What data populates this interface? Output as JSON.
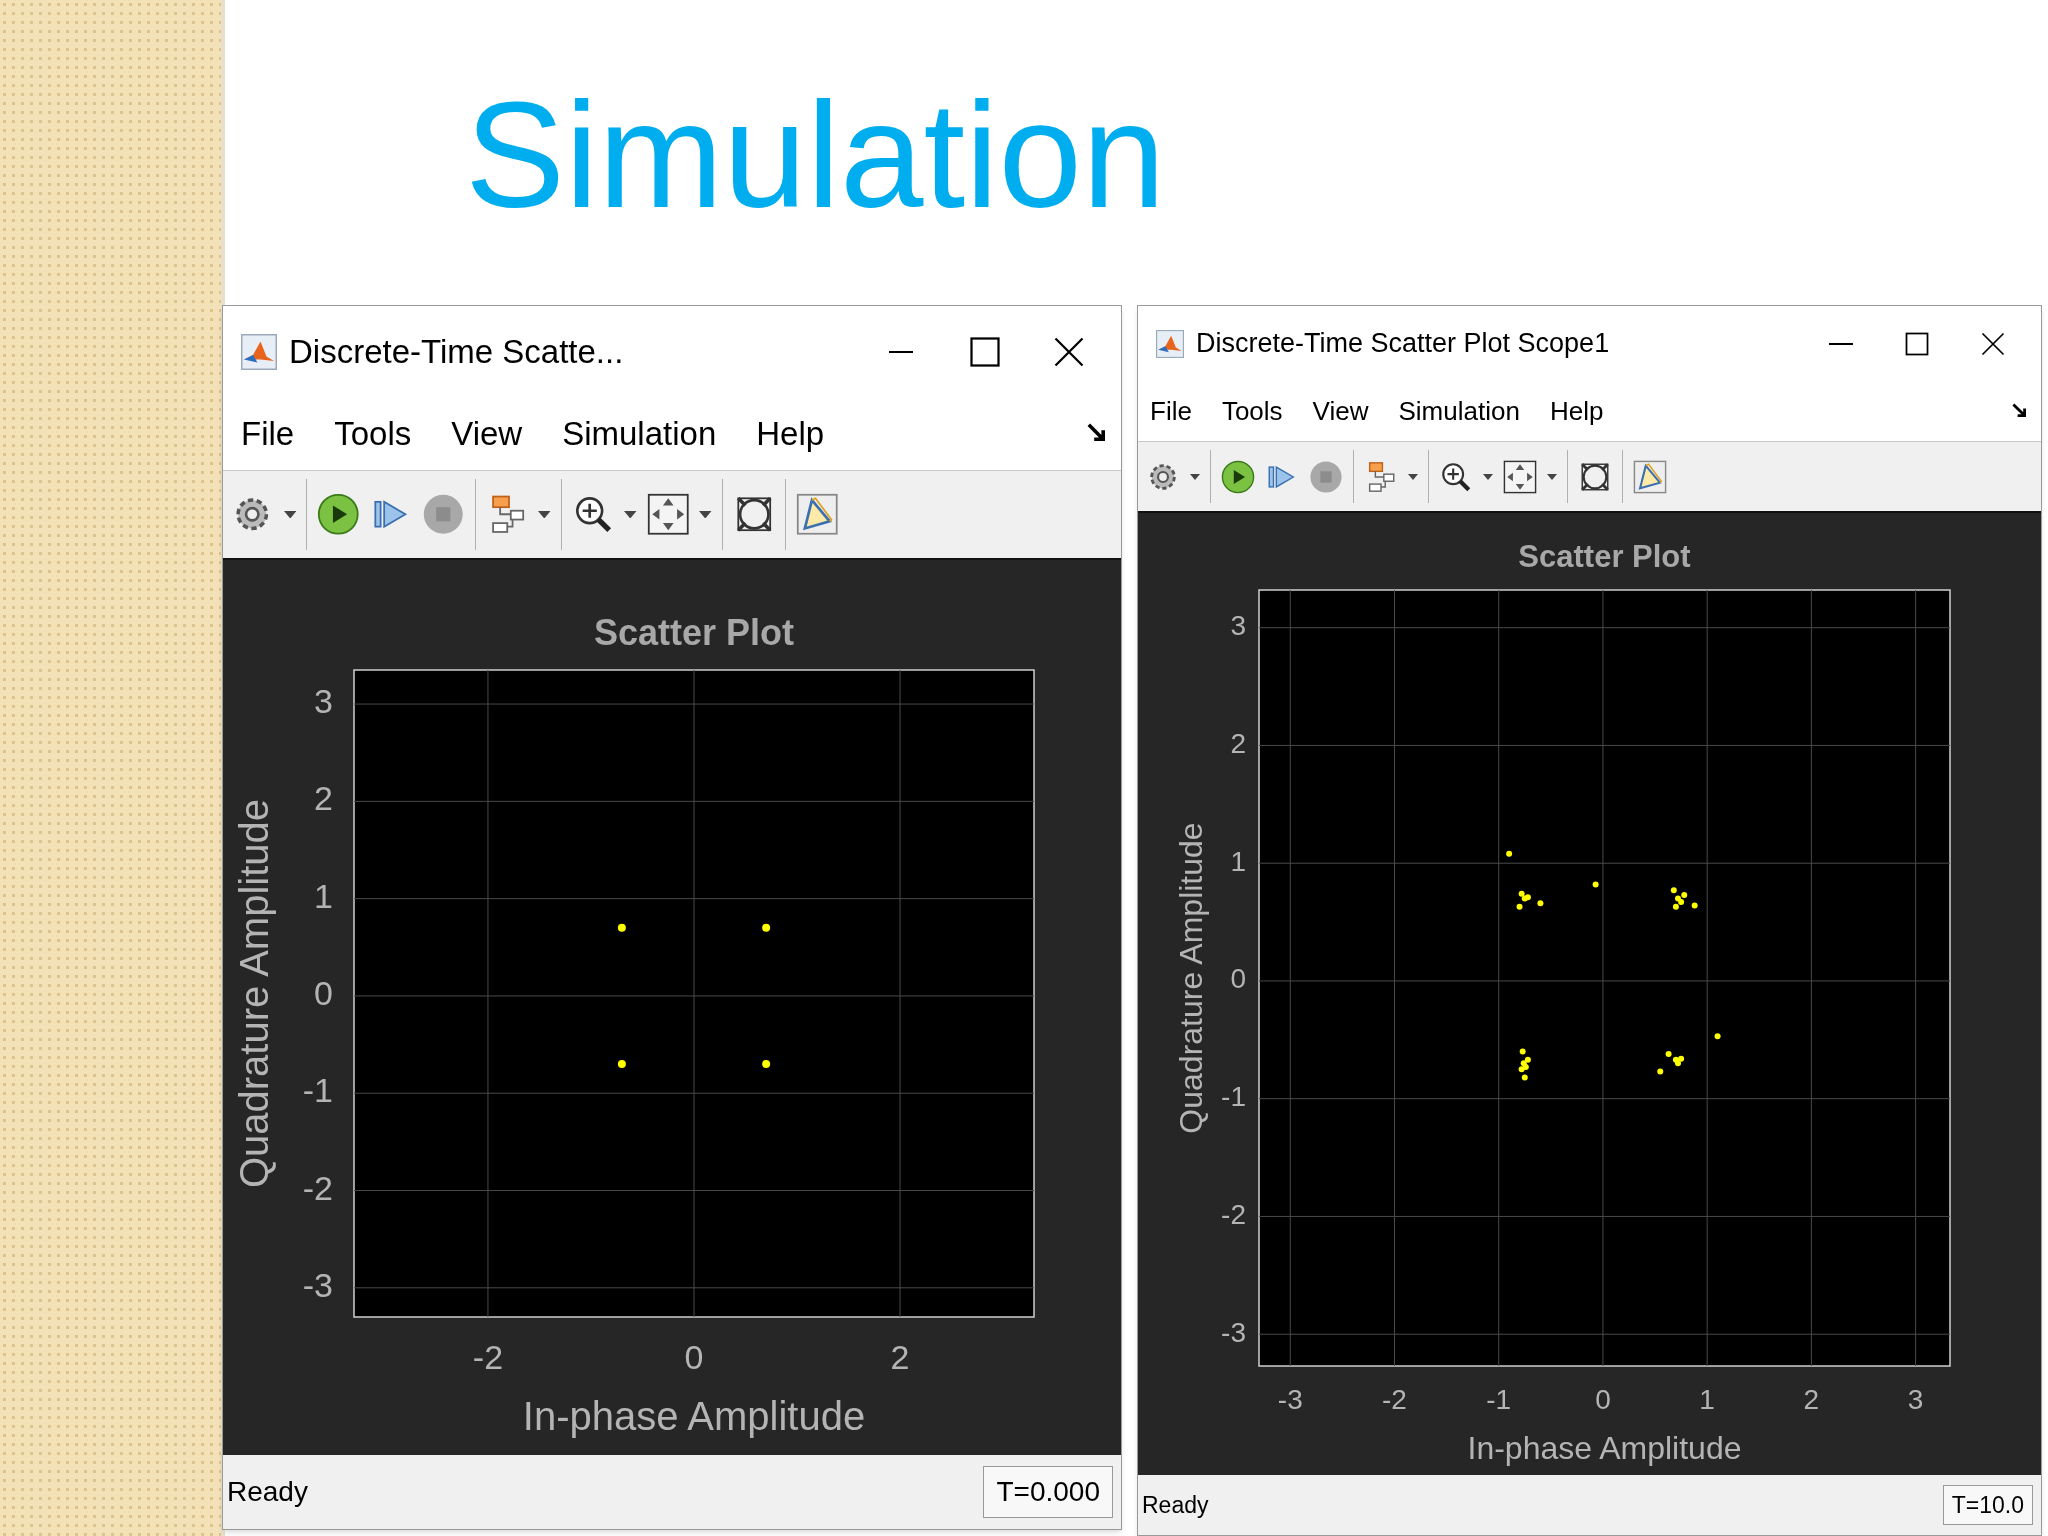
{
  "slide": {
    "title": "Simulation"
  },
  "windows": [
    {
      "title": "Discrete-Time Scatte...",
      "menu": [
        "File",
        "Tools",
        "View",
        "Simulation",
        "Help"
      ],
      "status": "Ready",
      "time": "T=0.000",
      "chart_data": {
        "type": "scatter",
        "grid": true,
        "title": "Scatter Plot",
        "xlabel": "In-phase Amplitude",
        "ylabel": "Quadrature Amplitude",
        "xlim": [
          -3.3,
          3.3
        ],
        "ylim": [
          -3.3,
          3.35
        ],
        "xticks": [
          -2,
          0,
          2
        ],
        "yticks": [
          -3,
          -2,
          -1,
          0,
          1,
          2,
          3
        ],
        "x": [
          -0.7,
          0.7,
          -0.7,
          0.7
        ],
        "series": [
          {
            "color": "#ffff00",
            "values": [
              0.7,
              0.7,
              -0.7,
              -0.7
            ]
          }
        ]
      }
    },
    {
      "title": "Discrete-Time Scatter Plot Scope1",
      "menu": [
        "File",
        "Tools",
        "View",
        "Simulation",
        "Help"
      ],
      "status": "Ready",
      "time": "T=10.0",
      "chart_data": {
        "type": "scatter",
        "grid": true,
        "title": "Scatter Plot",
        "xlabel": "In-phase Amplitude",
        "ylabel": "Quadrature Amplitude",
        "xlim": [
          -3.3,
          3.33
        ],
        "ylim": [
          -3.27,
          3.32
        ],
        "xticks": [
          -3,
          -2,
          -1,
          0,
          1,
          2,
          3
        ],
        "yticks": [
          -3,
          -2,
          -1,
          0,
          1,
          2,
          3
        ],
        "x": [
          -0.9,
          -0.07,
          -0.78,
          -0.75,
          -0.72,
          -0.8,
          -0.6,
          0.68,
          0.72,
          0.78,
          0.7,
          0.75,
          0.88,
          1.1,
          0.55,
          0.63,
          0.7,
          0.75,
          0.72,
          -0.77,
          -0.76,
          -0.74,
          -0.78,
          -0.75,
          -0.72
        ],
        "series": [
          {
            "color": "#ffff00",
            "values": [
              1.08,
              0.82,
              0.74,
              0.7,
              0.71,
              0.63,
              0.66,
              0.77,
              0.7,
              0.73,
              0.63,
              0.67,
              0.64,
              -0.47,
              -0.77,
              -0.62,
              -0.67,
              -0.66,
              -0.7,
              -0.6,
              -0.7,
              -0.73,
              -0.75,
              -0.82,
              -0.67
            ]
          }
        ]
      }
    }
  ]
}
